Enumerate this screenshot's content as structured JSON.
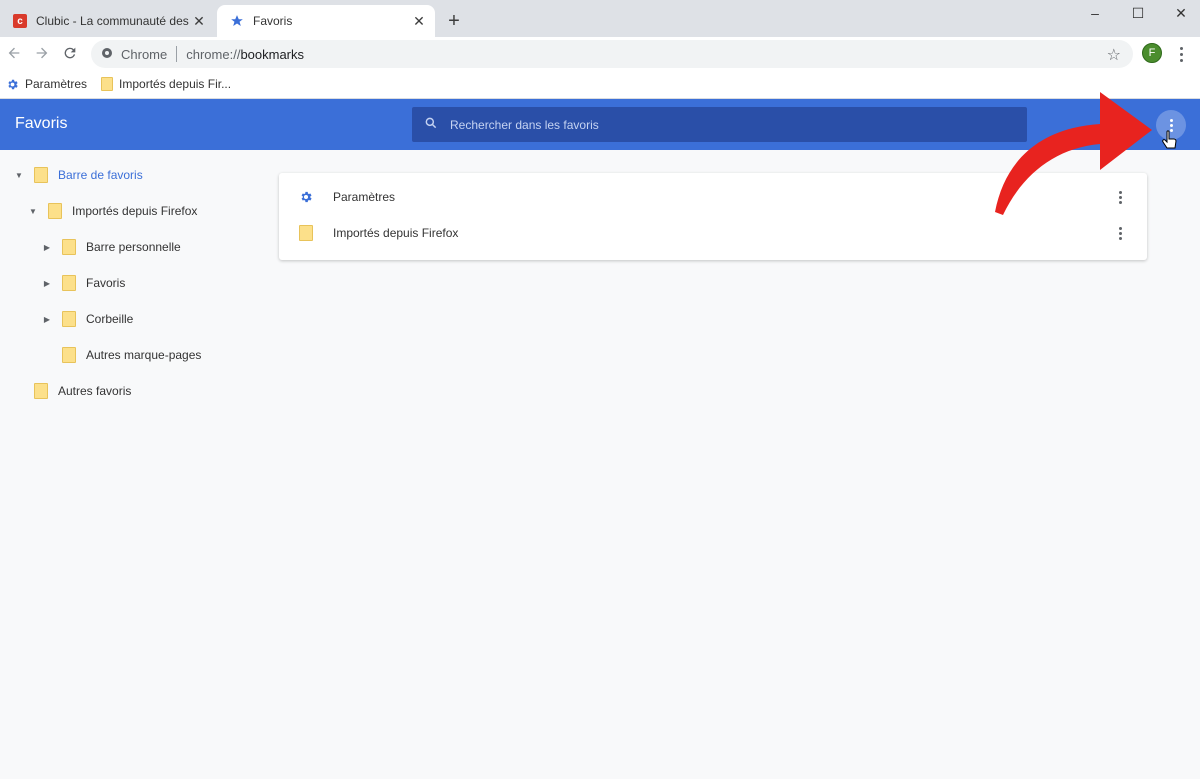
{
  "tabs": [
    {
      "title": "Clubic - La communauté des passionnés",
      "favicon": "clubic-icon",
      "active": false
    },
    {
      "title": "Favoris",
      "favicon": "star-icon",
      "active": true
    }
  ],
  "window_controls": {
    "minimize": "–",
    "maximize": "☐",
    "close": "✕"
  },
  "toolbar": {
    "chip": "Chrome",
    "url_scheme": "chrome://",
    "url_host": "bookmarks",
    "avatar_initial": "F"
  },
  "bookmarks_bar": [
    {
      "label": "Paramètres",
      "icon": "gear-icon"
    },
    {
      "label": "Importés depuis Fir...",
      "icon": "folder-icon"
    }
  ],
  "header": {
    "title": "Favoris",
    "search_placeholder": "Rechercher dans les favoris",
    "accent": "#3b6fd8"
  },
  "tree": [
    {
      "label": "Barre de favoris",
      "expanded": true,
      "selected": true
    },
    {
      "label": "Importés depuis Firefox",
      "expanded": true
    },
    {
      "label": "Barre personnelle",
      "expanded": false
    },
    {
      "label": "Favoris",
      "expanded": false
    },
    {
      "label": "Corbeille",
      "expanded": false
    },
    {
      "label": "Autres marque-pages"
    },
    {
      "label": "Autres favoris"
    }
  ],
  "list": [
    {
      "label": "Paramètres",
      "icon": "gear-icon"
    },
    {
      "label": "Importés depuis Firefox",
      "icon": "folder-icon"
    }
  ]
}
